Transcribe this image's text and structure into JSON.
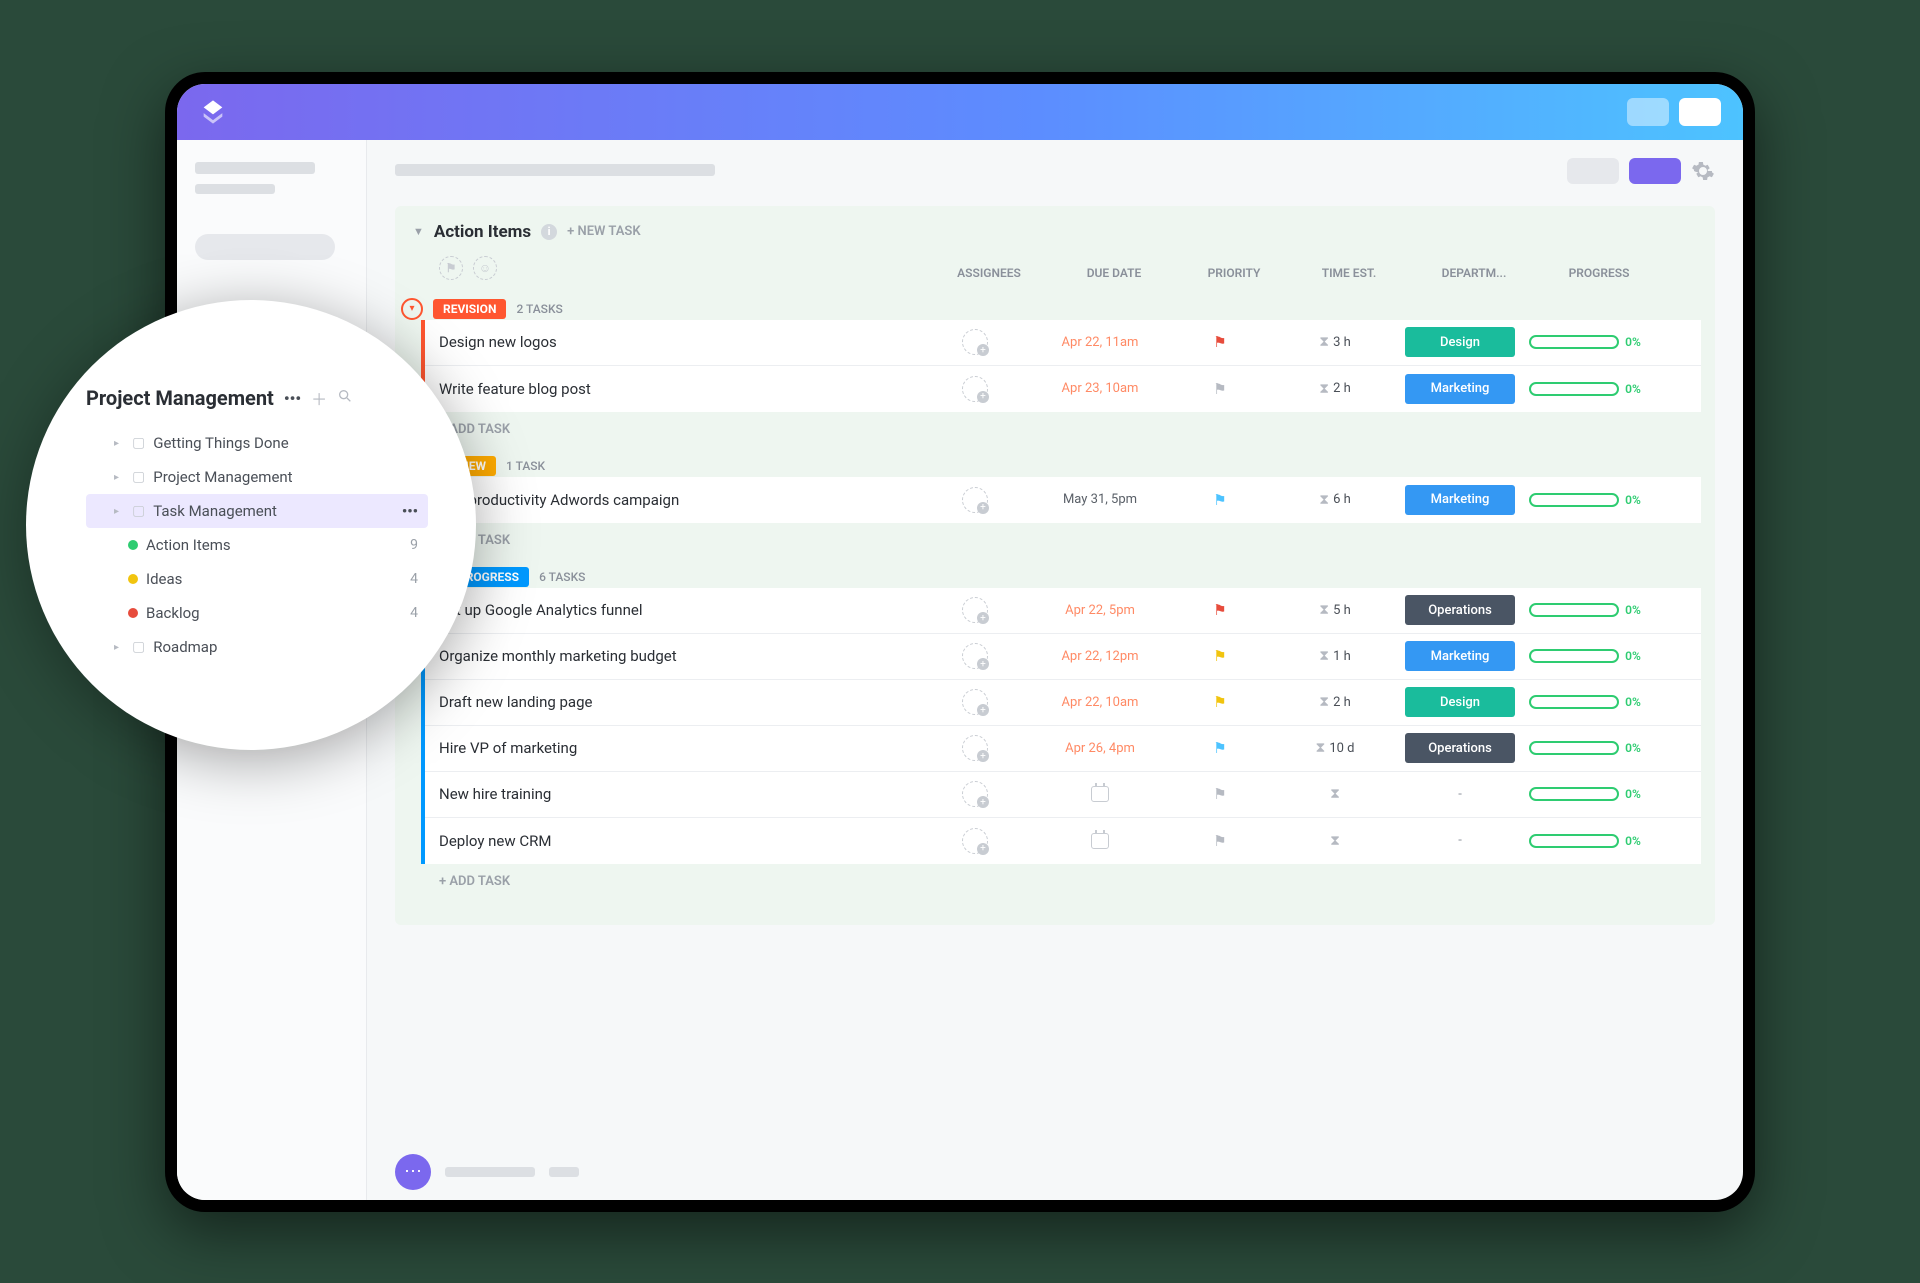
{
  "lens": {
    "title": "Project Management",
    "items": [
      {
        "label": "Getting Things Done",
        "count": ""
      },
      {
        "label": "Project Management",
        "count": ""
      },
      {
        "label": "Task Management",
        "count": "",
        "active": true
      },
      {
        "label": "Action Items",
        "count": "9",
        "dot": "#2ecc71"
      },
      {
        "label": "Ideas",
        "count": "4",
        "dot": "#f1c40f"
      },
      {
        "label": "Backlog",
        "count": "4",
        "dot": "#e74c3c"
      },
      {
        "label": "Roadmap",
        "count": ""
      }
    ]
  },
  "panel": {
    "title": "Action Items",
    "new_task": "+ NEW TASK"
  },
  "columns": [
    "ASSIGNEES",
    "DUE DATE",
    "PRIORITY",
    "TIME EST.",
    "DEPARTM...",
    "PROGRESS"
  ],
  "add_task_label": "+ ADD TASK",
  "groups": [
    {
      "name": "REVISION",
      "color": "#ff5630",
      "count_label": "2 TASKS",
      "tasks": [
        {
          "title": "Design new logos",
          "due": "Apr 22, 11am",
          "due_neutral": false,
          "priority_color": "#e74c3c",
          "est": "3 h",
          "dept": "Design",
          "dept_class": "dept-design",
          "progress": "0%"
        },
        {
          "title": "Write feature blog post",
          "due": "Apr 23, 10am",
          "due_neutral": false,
          "priority_color": "#b6bac2",
          "est": "2 h",
          "dept": "Marketing",
          "dept_class": "dept-marketing",
          "progress": "0%"
        }
      ]
    },
    {
      "name": "REVIEW",
      "color": "#ffab00",
      "count_label": "1 TASK",
      "tasks": [
        {
          "title": "Run productivity Adwords campaign",
          "due": "May 31, 5pm",
          "due_neutral": true,
          "priority_color": "#4dc3ff",
          "est": "6 h",
          "dept": "Marketing",
          "dept_class": "dept-marketing",
          "progress": "0%"
        }
      ]
    },
    {
      "name": "IN PROGRESS",
      "color": "#0099ff",
      "count_label": "6 TASKS",
      "tasks": [
        {
          "title": "Set up Google Analytics funnel",
          "due": "Apr 22, 5pm",
          "due_neutral": false,
          "priority_color": "#e74c3c",
          "est": "5 h",
          "dept": "Operations",
          "dept_class": "dept-operations",
          "progress": "0%"
        },
        {
          "title": "Organize monthly marketing budget",
          "due": "Apr 22, 12pm",
          "due_neutral": false,
          "priority_color": "#f1c40f",
          "est": "1 h",
          "dept": "Marketing",
          "dept_class": "dept-marketing",
          "progress": "0%"
        },
        {
          "title": "Draft new landing page",
          "due": "Apr 22, 10am",
          "due_neutral": false,
          "priority_color": "#f1c40f",
          "est": "2 h",
          "dept": "Design",
          "dept_class": "dept-design",
          "progress": "0%"
        },
        {
          "title": "Hire VP of marketing",
          "due": "Apr 26, 4pm",
          "due_neutral": false,
          "priority_color": "#4dc3ff",
          "est": "10 d",
          "dept": "Operations",
          "dept_class": "dept-operations",
          "progress": "0%"
        },
        {
          "title": "New hire training",
          "due": "",
          "due_neutral": true,
          "priority_color": "#b6bac2",
          "est": "",
          "dept": "-",
          "dept_class": "dept-none",
          "progress": "0%"
        },
        {
          "title": "Deploy new CRM",
          "due": "",
          "due_neutral": true,
          "priority_color": "#b6bac2",
          "est": "",
          "dept": "-",
          "dept_class": "dept-none",
          "progress": "0%"
        }
      ]
    }
  ]
}
